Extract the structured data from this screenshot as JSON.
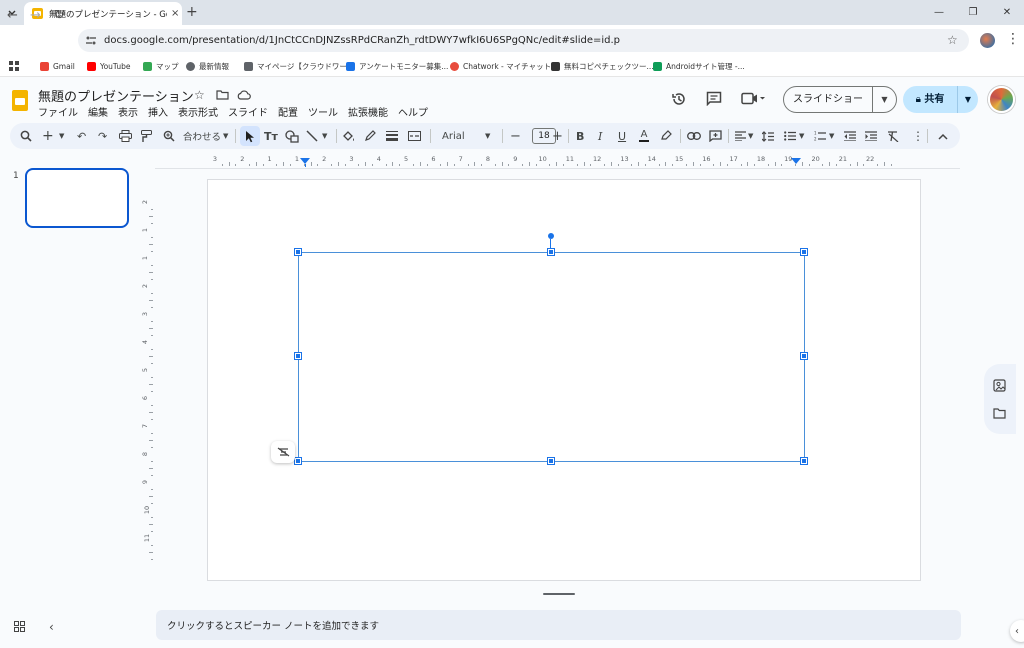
{
  "browser": {
    "tab_title": "無題のプレゼンテーション - Google",
    "tab_close": "×",
    "new_tab": "+",
    "url": "docs.google.com/presentation/d/1JnCtCCnDJNZssRPdCRanZh_rdtDWY7wfkI6U6SPgQNc/edit#slide=id.p",
    "window_controls": [
      "—",
      "❐",
      "✕"
    ]
  },
  "bookmarks": [
    {
      "label": "Gmail",
      "color": "#ea4335"
    },
    {
      "label": "YouTube",
      "color": "#ff0000"
    },
    {
      "label": "マップ",
      "color": "#34a853"
    },
    {
      "label": "最新情報",
      "color": "#5f6368"
    },
    {
      "label": "マイページ【クラウドワー...",
      "color": "#5f6368"
    },
    {
      "label": "アンケートモニター募集...",
      "color": "#1a73e8"
    },
    {
      "label": "Chatwork - マイチャット",
      "color": "#e84c3d"
    },
    {
      "label": "無料コピペチェックツー...",
      "color": "#333333"
    },
    {
      "label": "Androidサイト管理 -...",
      "color": "#0f9d58"
    }
  ],
  "doc": {
    "title": "無題のプレゼンテーション",
    "menu": [
      "ファイル",
      "編集",
      "表示",
      "挿入",
      "表示形式",
      "スライド",
      "配置",
      "ツール",
      "拡張機能",
      "ヘルプ"
    ],
    "slideshow_label": "スライドショー",
    "share_label": "共有"
  },
  "toolbar": {
    "zoom_label": "合わせる",
    "font_name": "Arial",
    "font_size": "18"
  },
  "ruler": {
    "h_labels": [
      "3",
      "2",
      "1",
      "1",
      "2",
      "3",
      "4",
      "5",
      "6",
      "7",
      "8",
      "9",
      "10",
      "11",
      "12",
      "13",
      "14",
      "15",
      "16",
      "17",
      "18",
      "19",
      "20",
      "21",
      "22"
    ],
    "v_labels": [
      "2",
      "1",
      "1",
      "2",
      "3",
      "4",
      "5",
      "6",
      "7",
      "8",
      "9",
      "10",
      "11"
    ]
  },
  "filmstrip": {
    "slide_number": "1"
  },
  "notes": {
    "placeholder": "クリックするとスピーカー ノートを追加できます"
  },
  "colors": {
    "accent": "#1a73e8",
    "share_bg": "#c2e7ff",
    "toolbar_bg": "#edf2fa",
    "brand_slides": "#f4b400"
  }
}
